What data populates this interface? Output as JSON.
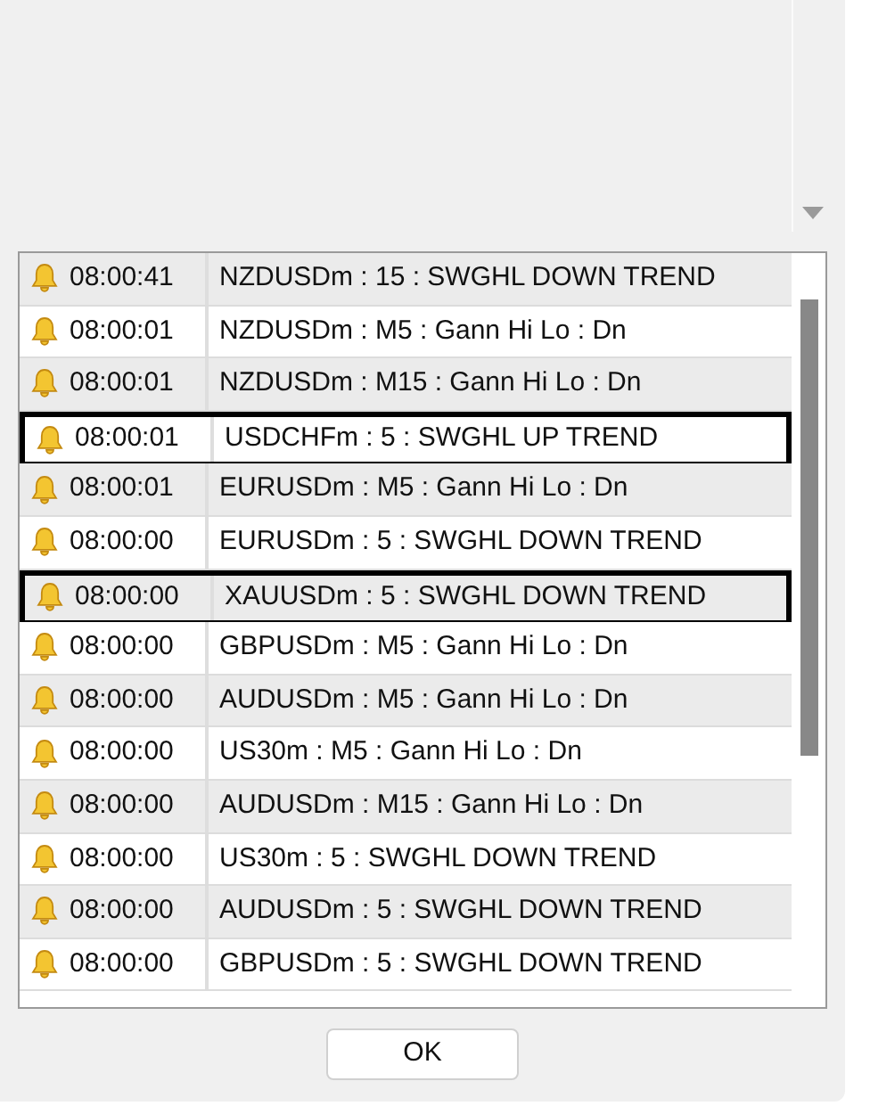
{
  "alerts": [
    {
      "time": "08:00:41",
      "message": "NZDUSDm : 15 : SWGHL DOWN TREND",
      "highlighted": false
    },
    {
      "time": "08:00:01",
      "message": "NZDUSDm : M5 : Gann Hi Lo : Dn",
      "highlighted": false
    },
    {
      "time": "08:00:01",
      "message": "NZDUSDm : M15 : Gann Hi Lo : Dn",
      "highlighted": false
    },
    {
      "time": "08:00:01",
      "message": "USDCHFm : 5 : SWGHL UP TREND",
      "highlighted": true
    },
    {
      "time": "08:00:01",
      "message": "EURUSDm : M5 : Gann Hi Lo : Dn",
      "highlighted": false
    },
    {
      "time": "08:00:00",
      "message": "EURUSDm : 5 : SWGHL DOWN TREND",
      "highlighted": false
    },
    {
      "time": "08:00:00",
      "message": "XAUUSDm : 5 : SWGHL DOWN TREND",
      "highlighted": true
    },
    {
      "time": "08:00:00",
      "message": "GBPUSDm : M5 : Gann Hi Lo : Dn",
      "highlighted": false
    },
    {
      "time": "08:00:00",
      "message": "AUDUSDm : M5 : Gann Hi Lo : Dn",
      "highlighted": false
    },
    {
      "time": "08:00:00",
      "message": "US30m : M5 : Gann Hi Lo : Dn",
      "highlighted": false
    },
    {
      "time": "08:00:00",
      "message": "AUDUSDm : M15 : Gann Hi Lo : Dn",
      "highlighted": false
    },
    {
      "time": "08:00:00",
      "message": "US30m : 5 : SWGHL DOWN TREND",
      "highlighted": false
    },
    {
      "time": "08:00:00",
      "message": "AUDUSDm : 5 : SWGHL DOWN TREND",
      "highlighted": false
    },
    {
      "time": "08:00:00",
      "message": "GBPUSDm : 5 : SWGHL DOWN TREND",
      "highlighted": false
    }
  ],
  "ok_button": "OK"
}
